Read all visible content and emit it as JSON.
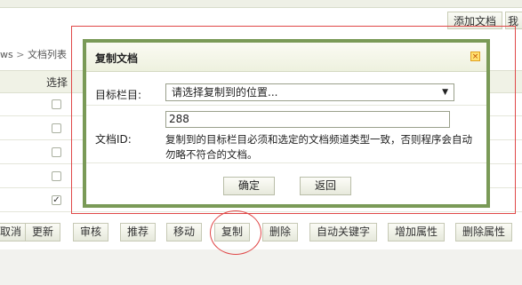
{
  "header": {
    "buttons": [
      {
        "label": "添加文档"
      },
      {
        "label": "我的"
      }
    ]
  },
  "breadcrumb": {
    "prefix": "ws",
    "separator": ">",
    "current": "文档列表"
  },
  "table": {
    "select_header": "选择",
    "rows": [
      {
        "checked": false
      },
      {
        "checked": false
      },
      {
        "checked": false
      },
      {
        "checked": false
      },
      {
        "checked": true
      }
    ],
    "check_mark": "✓"
  },
  "actions": {
    "buttons": [
      {
        "label": "取消"
      },
      {
        "label": "更新"
      },
      {
        "label": "审核"
      },
      {
        "label": "推荐"
      },
      {
        "label": "移动"
      },
      {
        "label": "复制"
      },
      {
        "label": "删除"
      },
      {
        "label": "自动关键字"
      },
      {
        "label": "增加属性"
      },
      {
        "label": "删除属性"
      }
    ]
  },
  "dialog": {
    "title": "复制文档",
    "close_icon": "×",
    "target_label": "目标栏目:",
    "target_select_value": "请选择复制到的位置...",
    "select_arrow": "▼",
    "doc_id_label": "文档ID:",
    "doc_id_value": "288",
    "note_line1": "复制到的目标栏目必须和选定的文档频道类型一致，否则程序会自动",
    "note_line2": "勿略不符合的文档。",
    "confirm_label": "确定",
    "back_label": "返回"
  },
  "colors": {
    "dialog_border": "#7a9a57",
    "annotation_red": "#e04848"
  }
}
